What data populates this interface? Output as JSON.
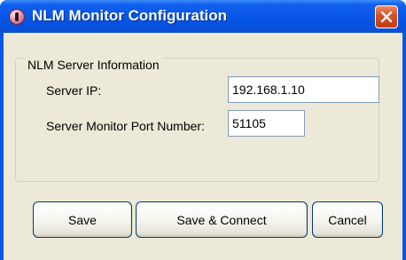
{
  "window": {
    "title": "NLM Monitor Configuration"
  },
  "group": {
    "label": "NLM Server Information"
  },
  "server_ip": {
    "label": "Server IP:",
    "value": "192.168.1.10"
  },
  "port": {
    "label": "Server Monitor Port Number:",
    "value": "51105"
  },
  "buttons": {
    "save": "Save",
    "save_connect": "Save & Connect",
    "cancel": "Cancel"
  },
  "colors": {
    "titlebar": "#0a56e6",
    "client": "#ece9d8",
    "close": "#d8552a"
  }
}
